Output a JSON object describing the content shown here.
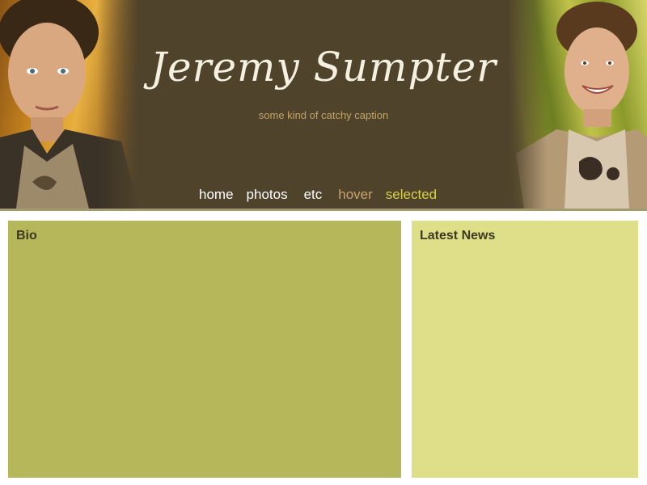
{
  "header": {
    "title": "Jeremy Sumpter",
    "caption": "some kind of catchy caption",
    "left_photo": "portrait-photo",
    "right_photo": "portrait-photo"
  },
  "nav": {
    "items": [
      "home",
      "photos",
      "etc",
      "hover",
      "selected"
    ]
  },
  "panels": {
    "bio": {
      "heading": "Bio"
    },
    "news": {
      "heading": "Latest News"
    }
  },
  "colors": {
    "header_bg": "#4f432c",
    "header_rule": "#a39a6e",
    "caption": "#c2a46a",
    "nav_default": "#ffffff",
    "nav_hover": "#c7a46c",
    "nav_selected": "#d6d04a",
    "bio_bg": "#b6b65a",
    "news_bg": "#dfdf8a"
  }
}
